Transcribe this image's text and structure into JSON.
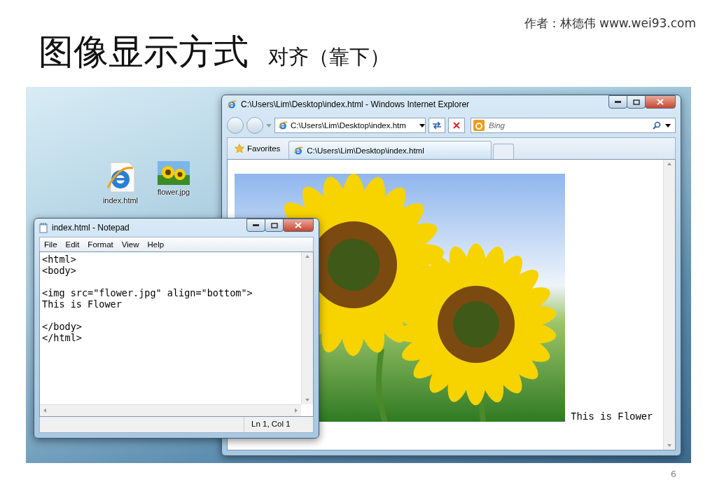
{
  "slide": {
    "author": "作者：林德伟 www.wei93.com",
    "title": "图像显示方式",
    "subtitle": "对齐（靠下）",
    "page_number": "6"
  },
  "desktop_icons": [
    {
      "label": "index.html",
      "kind": "browser"
    },
    {
      "label": "flower.jpg",
      "kind": "image"
    }
  ],
  "browser": {
    "title": "C:\\Users\\Lim\\Desktop\\index.html - Windows Internet Explorer",
    "address": "C:\\Users\\Lim\\Desktop\\index.htm",
    "search_placeholder": "Bing",
    "favorites": "Favorites",
    "tabs": [
      {
        "label": "C:\\Users\\Lim\\Desktop\\index.html",
        "selected": true
      }
    ],
    "page_text": "This is Flower"
  },
  "notepad": {
    "title": "index.html - Notepad",
    "menu": [
      "File",
      "Edit",
      "Format",
      "View",
      "Help"
    ],
    "text": "<html>\n<body>\n\n<img src=\"flower.jpg\" align=\"bottom\">\nThis is Flower\n\n</body>\n</html>",
    "status": "Ln 1, Col 1"
  }
}
